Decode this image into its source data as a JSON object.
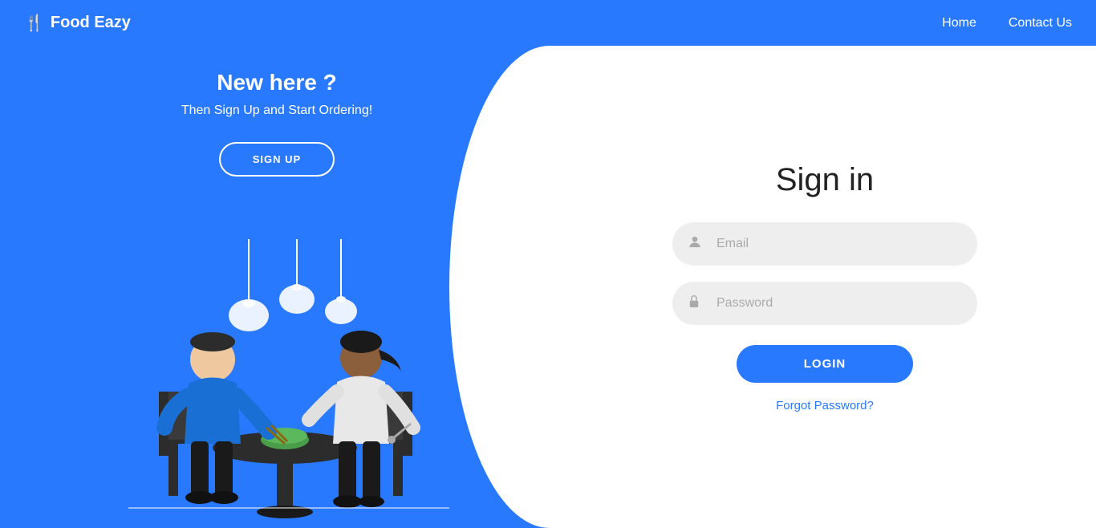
{
  "navbar": {
    "brand_name": "Food Eazy",
    "brand_icon": "🍴",
    "nav_links": [
      {
        "label": "Home",
        "id": "home"
      },
      {
        "label": "Contact Us",
        "id": "contact"
      }
    ]
  },
  "left_panel": {
    "heading": "New here ?",
    "subheading": "Then Sign Up and Start Ordering!",
    "signup_button": "SIGN UP"
  },
  "right_panel": {
    "title": "Sign in",
    "email_placeholder": "Email",
    "password_placeholder": "Password",
    "login_button": "LOGIN",
    "forgot_password": "Forgot Password?"
  },
  "colors": {
    "primary": "#2979FF",
    "white": "#ffffff",
    "input_bg": "#eeeeee"
  }
}
